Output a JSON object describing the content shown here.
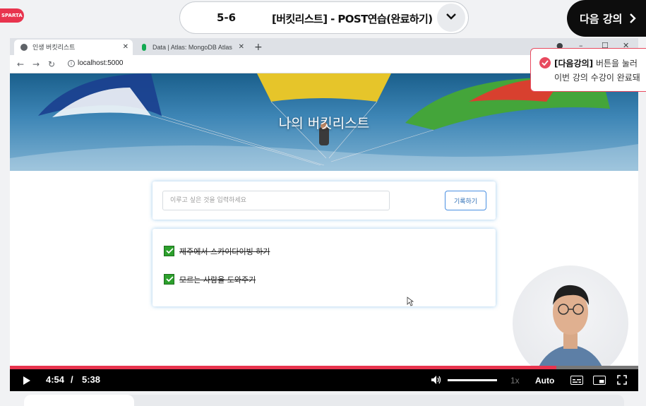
{
  "course": {
    "lesson_number": "5-6",
    "lesson_title": "[버킷리스트] - POST연습(완료하기)",
    "next_button": "다음 강의"
  },
  "browser": {
    "tabs": [
      {
        "label": "인생 버킷리스트",
        "active": true
      },
      {
        "label": "Data | Atlas: MongoDB Atlas",
        "active": false
      }
    ],
    "url": "localhost:5000"
  },
  "webpage": {
    "hero_title": "나의 버킷리스트",
    "input_placeholder": "이루고 싶은 것을 입력하세요",
    "record_button": "기록하기",
    "items": [
      {
        "text": "제주에서 스카이다이빙 하기",
        "done": true
      },
      {
        "text": "모르는 사람을 도와주기",
        "done": true
      }
    ]
  },
  "toast": {
    "highlight": "[다음강의]",
    "line1_rest": " 버튼을 눌러",
    "line2": "이번 강의 수강이 완료돼"
  },
  "player": {
    "current_time": "4:54",
    "separator": "/",
    "duration": "5:38",
    "progress": 0.87,
    "volume": 1.0,
    "speed": "1x",
    "quality": "Auto"
  },
  "colors": {
    "accent": "#e8344e",
    "check_green": "#2ca02c",
    "toast_border": "#e84a5f"
  }
}
